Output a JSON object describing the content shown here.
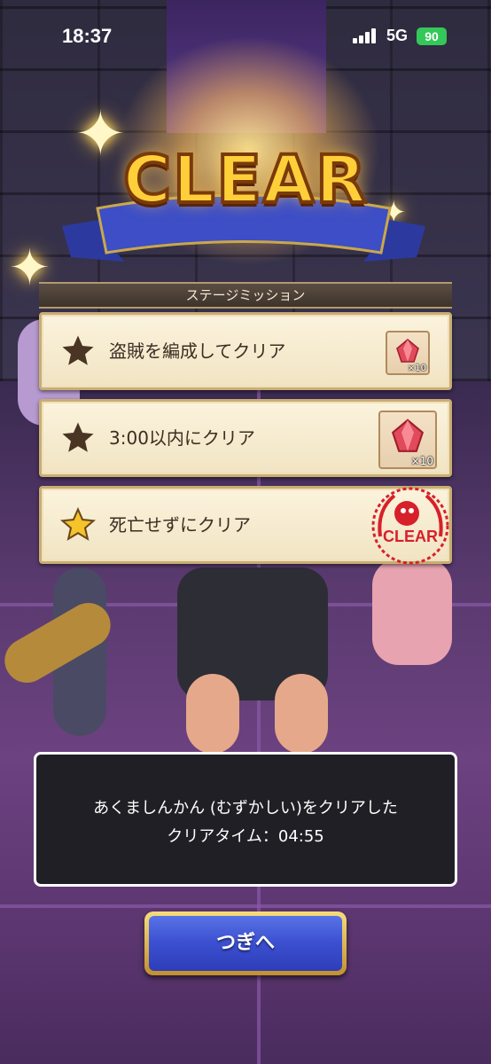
{
  "status_bar": {
    "time": "18:37",
    "network": "5G",
    "battery": "90"
  },
  "title": "CLEAR",
  "mission_header": "ステージミッション",
  "missions": [
    {
      "label": "盗賊を編成してクリア",
      "star": "filled-dark",
      "reward_qty": "×10",
      "reward_icon": "red-gem-icon",
      "status": "pending"
    },
    {
      "label": "3:00以内にクリア",
      "star": "filled-dark",
      "reward_qty": "×10",
      "reward_icon": "red-gem-icon",
      "status": "pending"
    },
    {
      "label": "死亡せずにクリア",
      "star": "filled-gold",
      "stamp_text": "CLEAR",
      "status": "cleared"
    }
  ],
  "result": {
    "line1": "あくましんかん (むずかしい)をクリアした",
    "line2": "クリアタイム：04:55"
  },
  "next_button": "つぎへ",
  "colors": {
    "title_gold": "#ffcf3a",
    "button_blue": "#3b4fd0",
    "stamp_red": "#d8202a",
    "panel_cream": "#fbf3dd"
  }
}
